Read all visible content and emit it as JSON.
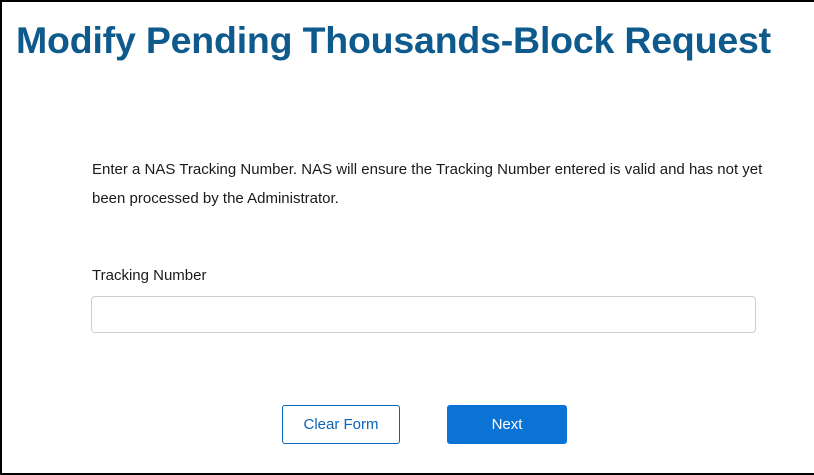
{
  "page": {
    "title": "Modify Pending Thousands-Block Request",
    "instructions": "Enter a NAS Tracking Number. NAS will ensure the Tracking Number entered is valid and has not yet been processed by the Administrator."
  },
  "form": {
    "tracking_number": {
      "label": "Tracking Number",
      "value": "",
      "placeholder": ""
    }
  },
  "actions": {
    "clear_label": "Clear Form",
    "next_label": "Next"
  },
  "colors": {
    "title": "#0e5a8c",
    "primary_button": "#0b72d6",
    "secondary_border": "#0b64b8",
    "input_border": "#cfcfcf"
  }
}
